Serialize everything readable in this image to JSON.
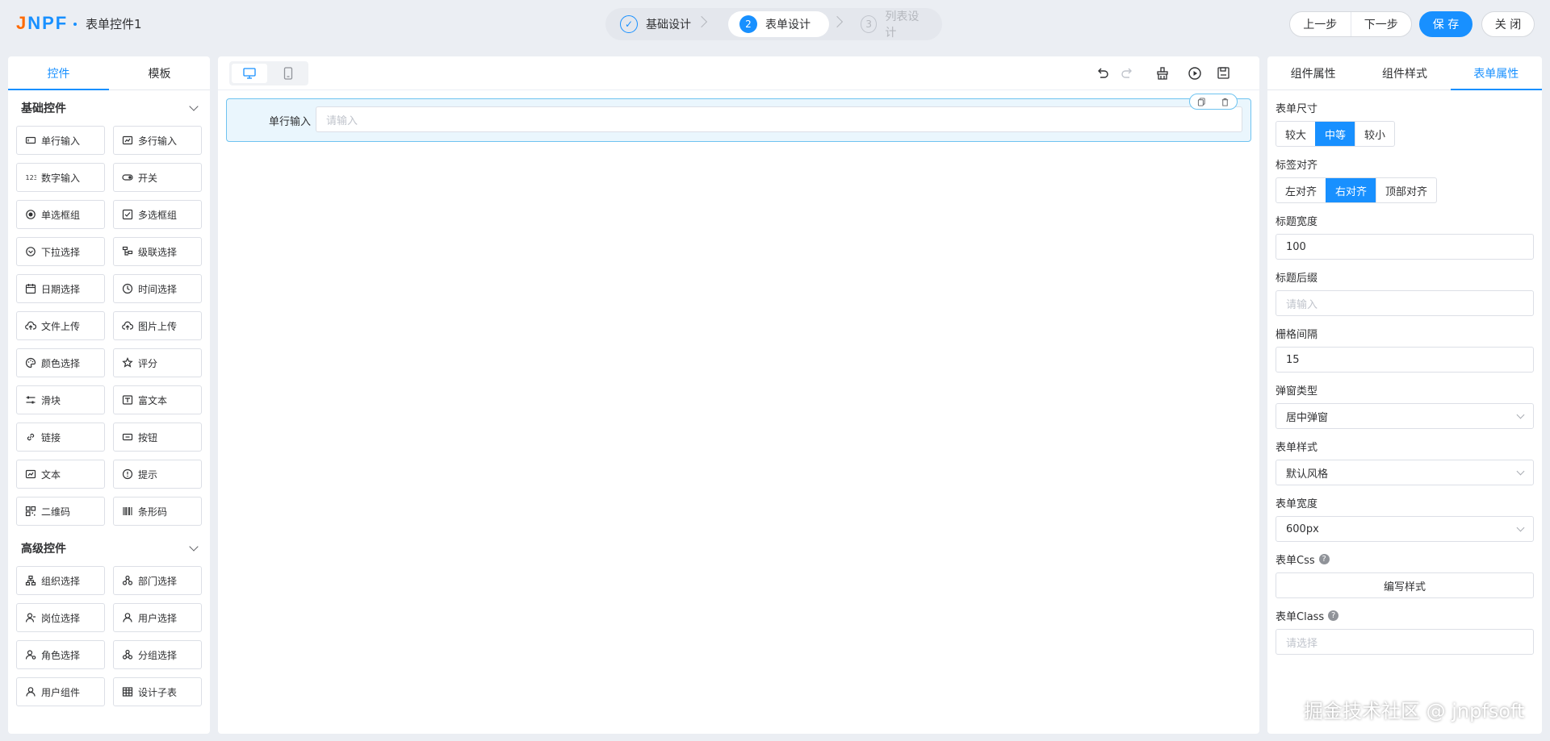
{
  "header": {
    "logo": "JNPF",
    "title": "表单控件1",
    "steps": [
      {
        "num": "✓",
        "label": "基础设计",
        "state": "done"
      },
      {
        "num": "2",
        "label": "表单设计",
        "state": "active"
      },
      {
        "num": "3",
        "label": "列表设计",
        "state": "todo"
      }
    ],
    "prev_label": "上一步",
    "next_label": "下一步",
    "save_label": "保 存",
    "close_label": "关 闭"
  },
  "left": {
    "tabs": [
      "控件",
      "模板"
    ],
    "groups": [
      {
        "title": "基础控件",
        "items": [
          {
            "label": "单行输入",
            "icon": "input-icon"
          },
          {
            "label": "多行输入",
            "icon": "textarea-icon"
          },
          {
            "label": "数字输入",
            "icon": "number-icon"
          },
          {
            "label": "开关",
            "icon": "switch-icon"
          },
          {
            "label": "单选框组",
            "icon": "radio-icon"
          },
          {
            "label": "多选框组",
            "icon": "checkbox-icon"
          },
          {
            "label": "下拉选择",
            "icon": "select-icon"
          },
          {
            "label": "级联选择",
            "icon": "cascader-icon"
          },
          {
            "label": "日期选择",
            "icon": "calendar-icon"
          },
          {
            "label": "时间选择",
            "icon": "clock-icon"
          },
          {
            "label": "文件上传",
            "icon": "upload-icon"
          },
          {
            "label": "图片上传",
            "icon": "image-upload-icon"
          },
          {
            "label": "颜色选择",
            "icon": "palette-icon"
          },
          {
            "label": "评分",
            "icon": "star-icon"
          },
          {
            "label": "滑块",
            "icon": "slider-icon"
          },
          {
            "label": "富文本",
            "icon": "richtext-icon"
          },
          {
            "label": "链接",
            "icon": "link-icon"
          },
          {
            "label": "按钮",
            "icon": "button-icon"
          },
          {
            "label": "文本",
            "icon": "text-icon"
          },
          {
            "label": "提示",
            "icon": "alert-icon"
          },
          {
            "label": "二维码",
            "icon": "qrcode-icon"
          },
          {
            "label": "条形码",
            "icon": "barcode-icon"
          }
        ]
      },
      {
        "title": "高级控件",
        "items": [
          {
            "label": "组织选择",
            "icon": "org-icon"
          },
          {
            "label": "部门选择",
            "icon": "dept-icon"
          },
          {
            "label": "岗位选择",
            "icon": "position-icon"
          },
          {
            "label": "用户选择",
            "icon": "user-icon"
          },
          {
            "label": "角色选择",
            "icon": "role-icon"
          },
          {
            "label": "分组选择",
            "icon": "group-icon"
          },
          {
            "label": "用户组件",
            "icon": "user-component-icon"
          },
          {
            "label": "设计子表",
            "icon": "table-icon"
          }
        ]
      }
    ]
  },
  "canvas": {
    "devices": [
      "pc-icon",
      "mobile-icon"
    ],
    "tools": [
      "undo-icon",
      "redo-icon",
      "clear-icon",
      "preview-icon",
      "save-json-icon"
    ],
    "field": {
      "label": "单行输入",
      "placeholder": "请输入"
    }
  },
  "right": {
    "tabs": [
      "组件属性",
      "组件样式",
      "表单属性"
    ],
    "active_tab": "表单属性",
    "size": {
      "label": "表单尺寸",
      "options": [
        "较大",
        "中等",
        "较小"
      ],
      "selected": "中等"
    },
    "align": {
      "label": "标签对齐",
      "options": [
        "左对齐",
        "右对齐",
        "顶部对齐"
      ],
      "selected": "右对齐"
    },
    "label_width": {
      "label": "标题宽度",
      "value": "100"
    },
    "label_suffix": {
      "label": "标题后缀",
      "placeholder": "请输入"
    },
    "gutter": {
      "label": "栅格间隔",
      "value": "15"
    },
    "popup_type": {
      "label": "弹窗类型",
      "value": "居中弹窗"
    },
    "form_style": {
      "label": "表单样式",
      "value": "默认风格"
    },
    "form_width": {
      "label": "表单宽度",
      "value": "600px"
    },
    "form_css": {
      "label": "表单Css",
      "button": "编写样式"
    },
    "form_class": {
      "label": "表单Class",
      "placeholder": "请选择"
    }
  },
  "watermark": "掘金技术社区 @ jnpfsoft",
  "colors": {
    "primary": "#1890ff",
    "logo_accent": "#ff6a00",
    "selected_bg": "#eaf6fd"
  }
}
